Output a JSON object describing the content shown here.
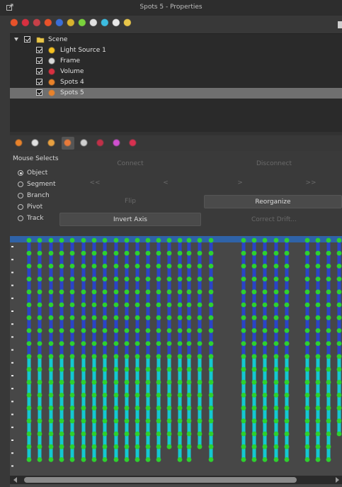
{
  "window": {
    "title": "Spots 5 - Properties"
  },
  "toolbar": {
    "icons": [
      "spots-icon",
      "volume-icon",
      "filament-icon",
      "spots-icon",
      "surfaces-icon",
      "cells-icon",
      "clipping-icon",
      "measurement-icon",
      "reference-frame-icon",
      "scissors-icon",
      "folder-icon"
    ]
  },
  "tree": {
    "root": {
      "label": "Scene",
      "checked": true,
      "expanded": true
    },
    "items": [
      {
        "label": "Light Source 1",
        "icon": "light-source-icon",
        "checked": true,
        "selected": false
      },
      {
        "label": "Frame",
        "icon": "frame-icon",
        "checked": true,
        "selected": false
      },
      {
        "label": "Volume",
        "icon": "volume-icon",
        "checked": true,
        "selected": false
      },
      {
        "label": "Spots 4",
        "icon": "spots-icon",
        "checked": true,
        "selected": false
      },
      {
        "label": "Spots 5",
        "icon": "spots-icon",
        "checked": true,
        "selected": true
      }
    ]
  },
  "tabs": [
    {
      "icon": "spots-tab-icon",
      "active": false
    },
    {
      "icon": "wand-icon",
      "active": false
    },
    {
      "icon": "pencil-icon",
      "active": false
    },
    {
      "icon": "edit-tracks-icon",
      "active": true
    },
    {
      "icon": "filter-icon",
      "active": false
    },
    {
      "icon": "statistics-icon",
      "active": false
    },
    {
      "icon": "color-icon",
      "active": false
    },
    {
      "icon": "settings-icon",
      "active": false
    }
  ],
  "edit": {
    "mouse_selects_label": "Mouse Selects",
    "options": [
      {
        "label": "Object",
        "selected": true
      },
      {
        "label": "Segment",
        "selected": false
      },
      {
        "label": "Branch",
        "selected": false
      },
      {
        "label": "Pivot",
        "selected": false
      },
      {
        "label": "Track",
        "selected": false
      }
    ],
    "connect": "Connect",
    "disconnect": "Disconnect",
    "nav": [
      "<<",
      "<",
      ">",
      ">>"
    ],
    "flip": "Flip",
    "reorganize": "Reorganize",
    "invert_axis": "Invert Axis",
    "correct_drift": "Correct Drift..."
  },
  "colors": {
    "window_bg": "#383838",
    "tree_bg": "#2a2a2a",
    "selection": "#6f6f6f",
    "canvas_bg": "#474747",
    "header_band": "#2f63a8",
    "dot": "#2ed12e",
    "line_blue": "#2a44c8",
    "line_cyan": "#14c8d2"
  },
  "tracks": [
    {
      "points": 18
    },
    {
      "points": 18
    },
    {
      "points": 18
    },
    {
      "points": 18
    },
    {
      "points": 18
    },
    {
      "points": 18
    },
    {
      "points": 18
    },
    {
      "points": 18
    },
    {
      "points": 18
    },
    {
      "points": 18
    },
    {
      "points": 18
    },
    {
      "points": 18
    },
    {
      "points": 18
    },
    {
      "points": 17
    },
    {
      "points": 18
    },
    {
      "points": 18
    },
    {
      "points": 17
    },
    {
      "points": 18
    },
    {
      "points": 18
    },
    {
      "points": 18
    },
    {
      "points": 18
    },
    {
      "points": 18
    },
    {
      "points": 18
    },
    {
      "points": 18
    },
    {
      "points": 18
    },
    {
      "points": 18
    },
    {
      "points": 16
    }
  ]
}
